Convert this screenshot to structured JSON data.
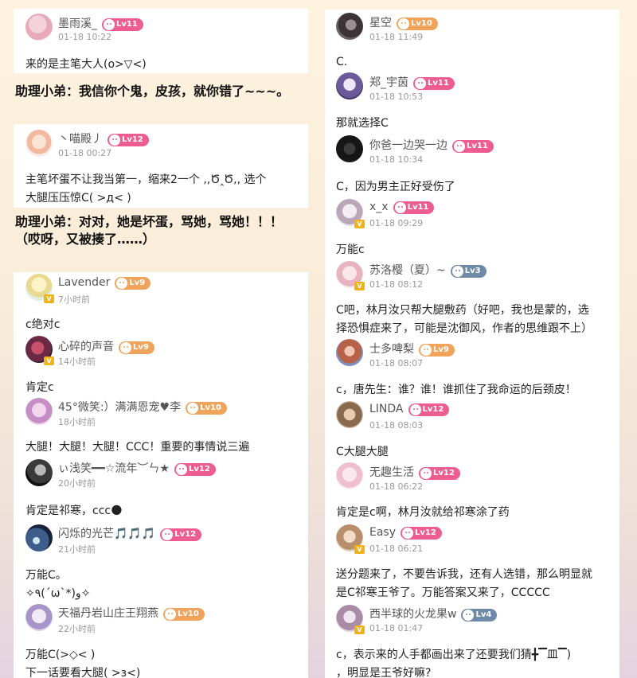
{
  "left_top": [
    {
      "user": "墨雨溪_",
      "level": "Lv11",
      "time": "01-18 10:22",
      "text": "来的是主笔大人(o>▽<)"
    },
    {
      "user": "丶喵殿丿",
      "level": "Lv12",
      "time": "01-18 00:27",
      "text_lines": [
        "主笔坏蛋不让我当第一，缩来2一个 ,,Ծ‸Ծ,,  选个",
        "大腿压压惊C( >д< )"
      ]
    }
  ],
  "notes": {
    "n1": "助理小弟：我信你个鬼，皮孩，就你错了~~~。",
    "n2_line1": "助理小弟：对对，她是坏蛋，骂她，骂她！！！",
    "n2_line2": "（哎呀，又被揍了……）"
  },
  "left_thread": [
    {
      "user": "Lavender",
      "level": "Lv9",
      "time": "7小时前",
      "text": "c绝对c"
    },
    {
      "user": "心碎的声音",
      "level": "Lv9",
      "time": "14小时前",
      "text": "肯定c"
    },
    {
      "user": "45°微笑:）满满恩宠♥李",
      "level": "Lv10",
      "time": "18小时前",
      "text": "大腿！大腿！大腿！CCC！重要的事情说三遍"
    },
    {
      "user": "ぃ浅笑━━☆流年︶ㄣ★",
      "level": "Lv12",
      "time": "20小时前",
      "text": "肯定是祁寒，ccc🌑"
    },
    {
      "user": "闪烁的光芒🎵🎵🎵",
      "level": "Lv12",
      "time": "21小时前",
      "text_lines": [
        "万能C。",
        "✧٩(ˊωˋ*)و✧"
      ]
    },
    {
      "user": "天福丹岩山庄王翔燕",
      "level": "Lv10",
      "time": "22小时前",
      "text_lines": [
        "万能C(>◇< )",
        "下一话要看大腿( >з<)"
      ]
    }
  ],
  "right_thread": [
    {
      "user": "星空",
      "level": "Lv10",
      "time": "01-18 11:49",
      "text": "C."
    },
    {
      "user": "郑_宇茵",
      "level": "Lv11",
      "time": "01-18 10:53",
      "text": "那就选择C"
    },
    {
      "user": "你爸一边哭一边",
      "level": "Lv11",
      "time": "01-18 10:34",
      "text": "C，因为男主正好受伤了"
    },
    {
      "user": "x_x",
      "level": "Lv11",
      "time": "01-18 09:29",
      "text": "万能c"
    },
    {
      "user": "苏洛樱（夏）~",
      "level": "Lv3",
      "time": "01-18 08:12",
      "text_lines": [
        "C吧，林月汝只帮大腿敷药（好吧，我也是蒙的，选",
        "择恐惧症来了，可能是沈御风，作者的思维跟不上）"
      ]
    },
    {
      "user": "士多啤梨",
      "level": "Lv9",
      "time": "01-18 08:07",
      "text": "c，唐先生：谁？谁！谁抓住了我命运的后颈皮！"
    },
    {
      "user": "LINDA",
      "level": "Lv12",
      "time": "01-18 08:03",
      "text": "C大腿大腿"
    },
    {
      "user": "无趣生活",
      "level": "Lv12",
      "time": "01-18 06:22",
      "text": "肯定是c啊，林月汝就给祁寒涂了药"
    },
    {
      "user": "Easy",
      "level": "Lv12",
      "time": "01-18 06:21",
      "text_lines": [
        "送分题来了，不要告诉我，还有人选错，那么明显就",
        "是C祁寒王爷了。万能答案又来了，CCCCC"
      ]
    },
    {
      "user": "西半球的火龙果w",
      "level": "Lv4",
      "time": "01-18 01:47",
      "text_lines": [
        "c，表示来的人手都画出来了还要我们猜╋▔皿▔)",
        "，明显是王爷好嘛?"
      ]
    }
  ],
  "colors": {
    "lv_pink": "#ee5d8f",
    "lv_orange": "#f0a35a",
    "lv_blue": "#6f8aa8",
    "vip_badge": "#f2b319"
  }
}
